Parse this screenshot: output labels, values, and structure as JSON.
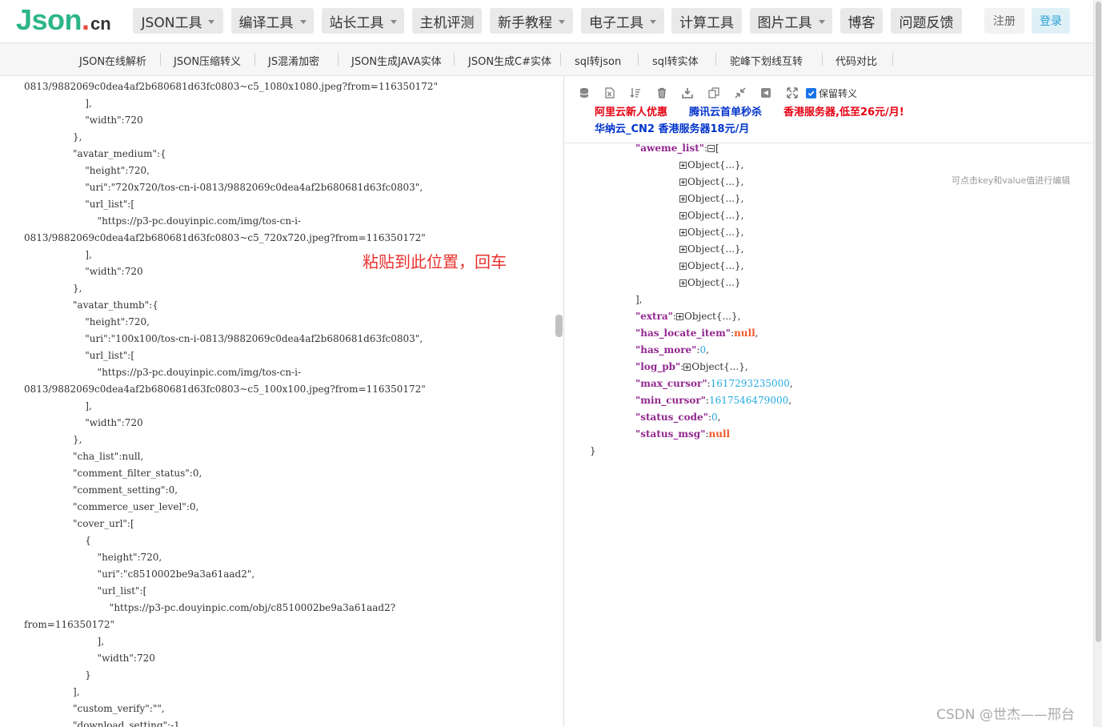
{
  "logo": {
    "json": "Json",
    "dot": ".",
    "cn": "cn"
  },
  "nav": {
    "items": [
      {
        "label": "JSON工具",
        "dropdown": true
      },
      {
        "label": "编译工具",
        "dropdown": true
      },
      {
        "label": "站长工具",
        "dropdown": true
      },
      {
        "label": "主机评测",
        "dropdown": false
      },
      {
        "label": "新手教程",
        "dropdown": true
      },
      {
        "label": "电子工具",
        "dropdown": true
      },
      {
        "label": "计算工具",
        "dropdown": false
      },
      {
        "label": "图片工具",
        "dropdown": true
      },
      {
        "label": "博客",
        "dropdown": false
      },
      {
        "label": "问题反馈",
        "dropdown": false
      }
    ],
    "register": "注册",
    "login": "登录"
  },
  "subnav": {
    "items": [
      "JSON在线解析",
      "JSON压缩转义",
      "JS混淆加密",
      "JSON生成JAVA实体",
      "JSON生成C#实体",
      "sql转json",
      "sql转实体",
      "驼峰下划线互转",
      "代码对比"
    ]
  },
  "editor": {
    "lines": [
      "0813/9882069c0dea4af2b680681d63fc0803~c5_1080x1080.jpeg?from=116350172\"",
      "                    ],",
      "                    \"width\":720",
      "                },",
      "                \"avatar_medium\":{",
      "                    \"height\":720,",
      "                    \"uri\":\"720x720/tos-cn-i-0813/9882069c0dea4af2b680681d63fc0803\",",
      "                    \"url_list\":[",
      "                        \"https://p3-pc.douyinpic.com/img/tos-cn-i-",
      "0813/9882069c0dea4af2b680681d63fc0803~c5_720x720.jpeg?from=116350172\"",
      "                    ],",
      "                    \"width\":720",
      "                },",
      "                \"avatar_thumb\":{",
      "                    \"height\":720,",
      "                    \"uri\":\"100x100/tos-cn-i-0813/9882069c0dea4af2b680681d63fc0803\",",
      "                    \"url_list\":[",
      "                        \"https://p3-pc.douyinpic.com/img/tos-cn-i-",
      "0813/9882069c0dea4af2b680681d63fc0803~c5_100x100.jpeg?from=116350172\"",
      "                    ],",
      "                    \"width\":720",
      "                },",
      "                \"cha_list\":null,",
      "                \"comment_filter_status\":0,",
      "                \"comment_setting\":0,",
      "                \"commerce_user_level\":0,",
      "                \"cover_url\":[",
      "                    {",
      "                        \"height\":720,",
      "                        \"uri\":\"c8510002be9a3a61aad2\",",
      "                        \"url_list\":[",
      "                            \"https://p3-pc.douyinpic.com/obj/c8510002be9a3a61aad2?",
      "from=116350172\"",
      "                        ],",
      "                        \"width\":720",
      "                    }",
      "                ],",
      "                \"custom_verify\":\"\",",
      "                \"download_setting\":-1,"
    ],
    "paste_hint": "粘贴到此位置，回车"
  },
  "toolbar": {
    "icons": [
      "database-icon",
      "file-excel-icon",
      "sort-icon",
      "trash-icon",
      "download-icon",
      "copy-icon",
      "compress-icon",
      "share-icon",
      "expand-icon"
    ],
    "keep_escape_label": "保留转义",
    "keep_escape_checked": true
  },
  "ads": [
    {
      "text": "阿里云新人优惠",
      "color": "#e60012"
    },
    {
      "text": "腾讯云首单秒杀",
      "color": "#0033cc"
    },
    {
      "text": "香港服务器,低至26元/月!",
      "color": "#e60012"
    },
    {
      "text": "华纳云_CN2 香港服务器18元/月",
      "color": "#0033cc"
    }
  ],
  "tree": {
    "aweme_list_key": "\"aweme_list\"",
    "objects": [
      "Object{...},",
      "Object{...},",
      "Object{...},",
      "Object{...},",
      "Object{...},",
      "Object{...},",
      "Object{...},",
      "Object{...}"
    ],
    "close_bracket": "],",
    "rows": [
      {
        "key": "\"extra\"",
        "type": "obj",
        "value": "Object{...},"
      },
      {
        "key": "\"has_locate_item\"",
        "type": "null",
        "value": "null",
        "suffix": ","
      },
      {
        "key": "\"has_more\"",
        "type": "num",
        "value": "0",
        "suffix": ","
      },
      {
        "key": "\"log_pb\"",
        "type": "obj",
        "value": "Object{...},"
      },
      {
        "key": "\"max_cursor\"",
        "type": "num",
        "value": "1617293235000",
        "suffix": ","
      },
      {
        "key": "\"min_cursor\"",
        "type": "num",
        "value": "1617546479000",
        "suffix": ","
      },
      {
        "key": "\"status_code\"",
        "type": "num",
        "value": "0",
        "suffix": ","
      },
      {
        "key": "\"status_msg\"",
        "type": "null",
        "value": "null",
        "suffix": ""
      }
    ],
    "end_brace": "}",
    "edit_hint": "可点击key和value值进行编辑"
  },
  "watermark": "CSDN @世杰——邢台"
}
